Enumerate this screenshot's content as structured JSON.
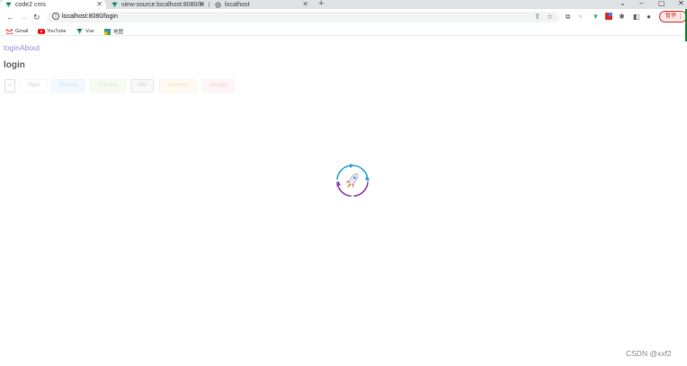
{
  "browser": {
    "tabs": [
      {
        "title": "code2 cms",
        "active": true,
        "close": "✕"
      },
      {
        "title": "view-source:localhost:8080/lo",
        "active": false,
        "close": "✕"
      },
      {
        "title": "localhost",
        "active": false,
        "close": "✕"
      }
    ],
    "new_tab": "+",
    "url": "localhost:8080/login",
    "profile_label": "暂停",
    "bookmarks": [
      {
        "label": "Gmail",
        "icon": "gmail-icon"
      },
      {
        "label": "YouTube",
        "icon": "youtube-icon"
      },
      {
        "label": "Vue",
        "icon": "vue-icon"
      },
      {
        "label": "地图",
        "icon": "maps-icon"
      }
    ]
  },
  "page": {
    "nav": {
      "login": "login",
      "about": "About"
    },
    "heading": "login",
    "buttons": {
      "search": "",
      "plain": "Plain",
      "primary": "Primary",
      "success": "Success",
      "info": "Info",
      "warning": "Warning",
      "danger": "Danger"
    }
  },
  "watermark": "CSDN @xxf2",
  "colors": {
    "accent": "#9b8ad4",
    "loader_blue": "#2ba6de",
    "loader_purple": "#8e44ad"
  }
}
